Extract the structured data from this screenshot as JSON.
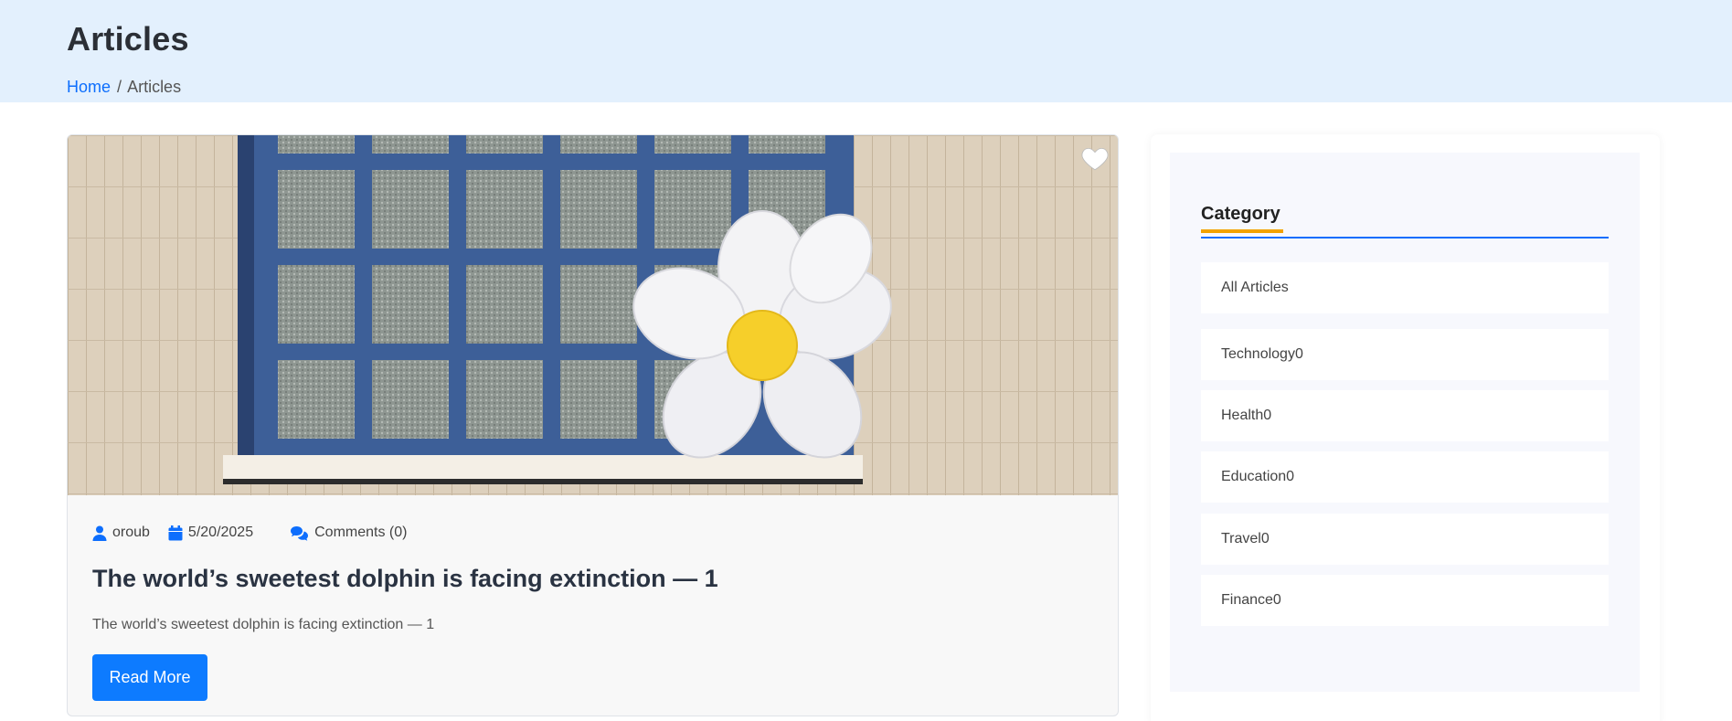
{
  "header": {
    "title": "Articles",
    "breadcrumb": {
      "home": "Home",
      "separator": "/",
      "current": "Articles"
    }
  },
  "article": {
    "image_alt": "Inflatable daisy balloon against a blue window on a tiled wall",
    "author": "oroub",
    "date": "5/20/2025",
    "comments": "Comments (0)",
    "title": "The world’s sweetest dolphin is facing extinction — 1",
    "excerpt": "The world’s sweetest dolphin is facing extinction — 1",
    "read_more": "Read More",
    "favorite_icon": "heart-icon"
  },
  "sidebar": {
    "category_title": "Category",
    "categories": [
      {
        "label": "All Articles"
      },
      {
        "label": "Technology0"
      },
      {
        "label": "Health0"
      },
      {
        "label": "Education0"
      },
      {
        "label": "Travel0"
      },
      {
        "label": "Finance0"
      }
    ]
  },
  "colors": {
    "header_bg": "#e3f0fd",
    "accent_blue": "#0d6efd",
    "button_blue": "#0d7bff",
    "accent_orange": "#f2a200"
  }
}
